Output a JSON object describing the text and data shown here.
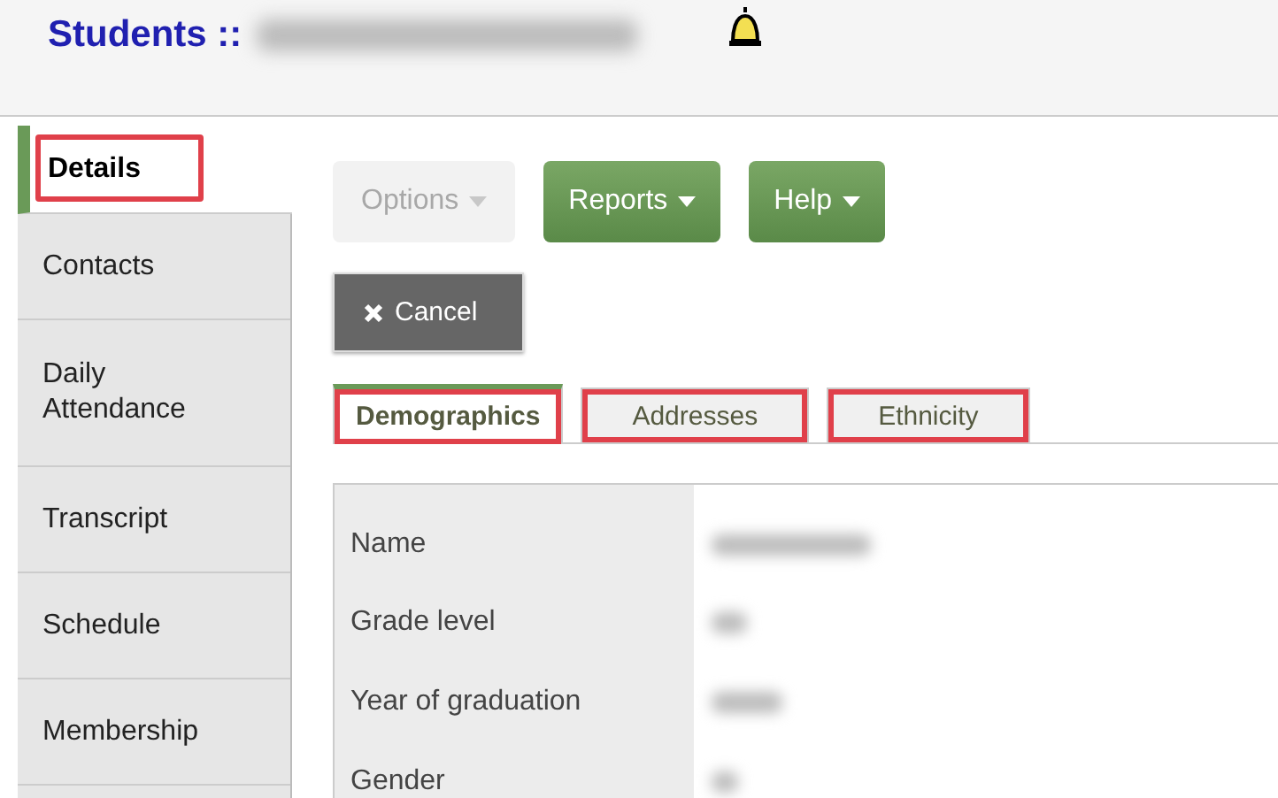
{
  "header": {
    "title": "Students ::",
    "name_blurred": true
  },
  "sidebar": {
    "items": [
      {
        "label": "Details",
        "selected": true,
        "highlighted": true
      },
      {
        "label": "Contacts",
        "selected": false,
        "highlighted": false
      },
      {
        "label": "Daily Attendance",
        "selected": false,
        "highlighted": false
      },
      {
        "label": "Transcript",
        "selected": false,
        "highlighted": false
      },
      {
        "label": "Schedule",
        "selected": false,
        "highlighted": false
      },
      {
        "label": "Membership",
        "selected": false,
        "highlighted": false
      }
    ]
  },
  "toolbar": [
    {
      "label": "Options",
      "kind": "dropdown",
      "disabled": true
    },
    {
      "label": "Reports",
      "kind": "dropdown",
      "disabled": false
    },
    {
      "label": "Help",
      "kind": "dropdown",
      "disabled": false
    }
  ],
  "cancel_button": {
    "label": "Cancel"
  },
  "tabs": [
    {
      "label": "Demographics",
      "selected": true,
      "highlighted": true
    },
    {
      "label": "Addresses",
      "selected": false,
      "highlighted": true
    },
    {
      "label": "Ethnicity",
      "selected": false,
      "highlighted": true
    }
  ],
  "fields": [
    {
      "label": "Name",
      "blurred": true
    },
    {
      "label": "Grade level",
      "blurred": true
    },
    {
      "label": "Year of graduation",
      "blurred": true
    },
    {
      "label": "Gender",
      "blurred": true
    }
  ]
}
